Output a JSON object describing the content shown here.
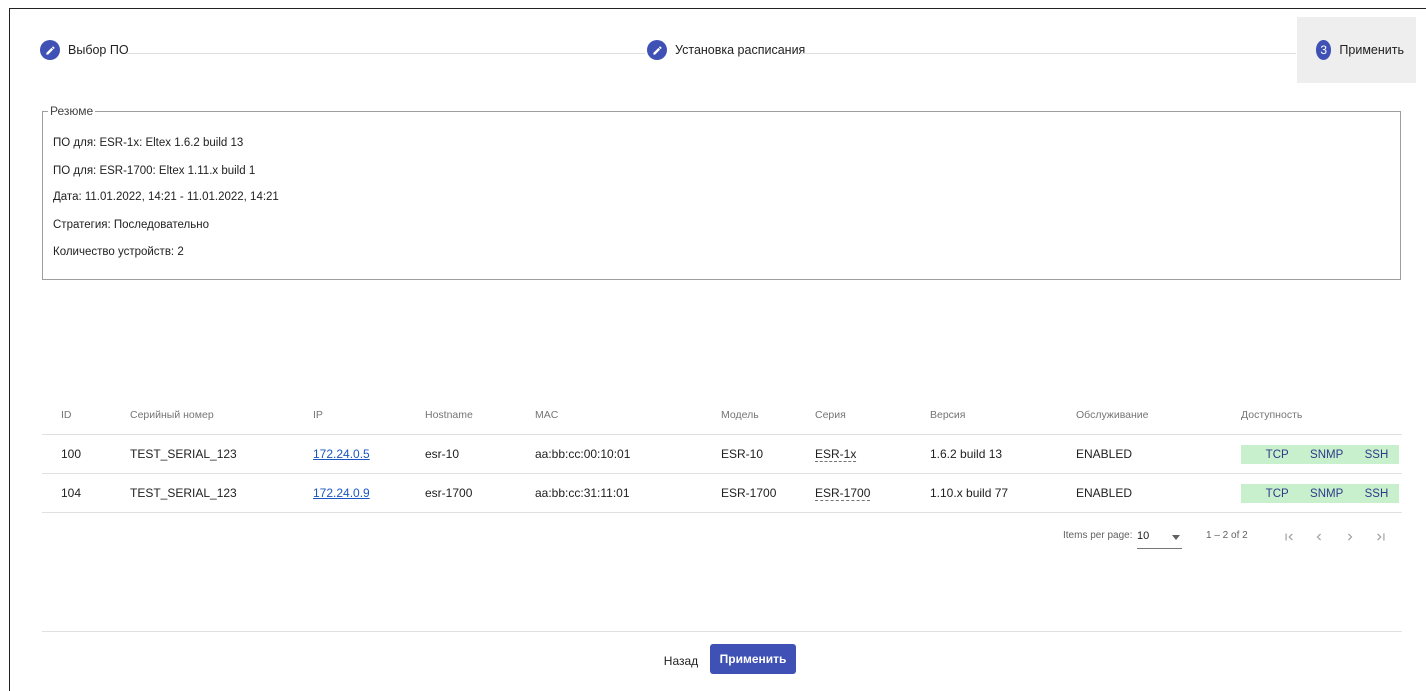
{
  "stepper": {
    "steps": [
      {
        "label": "Выбор ПО",
        "icon": "edit-icon"
      },
      {
        "label": "Установка расписания",
        "icon": "edit-icon"
      },
      {
        "label": "Применить",
        "number": "3"
      }
    ]
  },
  "summary": {
    "legend": "Резюме",
    "rows": [
      {
        "key": "ПО для: ESR-1x:",
        "value": " Eltex 1.6.2 build 13"
      },
      {
        "key": "ПО для: ESR-1700:",
        "value": " Eltex 1.11.x build 1"
      },
      {
        "key": "Дата:",
        "value": " 11.01.2022, 14:21 - 11.01.2022, 14:21"
      },
      {
        "key": "Стратегия:",
        "value": " Последовательно"
      },
      {
        "key": "Количество устройств:",
        "value": " 2"
      }
    ]
  },
  "table": {
    "headers": [
      "ID",
      "Серийный номер",
      "IP",
      "Hostname",
      "MAC",
      "Модель",
      "Серия",
      "Версия",
      "Обслуживание",
      "Доступность"
    ],
    "rows": [
      {
        "id": "100",
        "serial": "TEST_SERIAL_123",
        "ip": "172.24.0.5",
        "hostname": "esr-10",
        "mac": "aa:bb:cc:00:10:01",
        "model": "ESR-10",
        "series": "ESR-1x",
        "version": "1.6.2 build 13",
        "service": "ENABLED",
        "availability": [
          "TCP",
          "SNMP",
          "SSH"
        ]
      },
      {
        "id": "104",
        "serial": "TEST_SERIAL_123",
        "ip": "172.24.0.9",
        "hostname": "esr-1700",
        "mac": "aa:bb:cc:31:11:01",
        "model": "ESR-1700",
        "series": "ESR-1700",
        "version": "1.10.x build 77",
        "service": "ENABLED",
        "availability": [
          "TCP",
          "SNMP",
          "SSH"
        ]
      }
    ]
  },
  "paginator": {
    "items_per_page_label": "Items per page:",
    "page_size": "10",
    "range": "1 – 2 of 2"
  },
  "footer": {
    "back_label": "Назад",
    "apply_label": "Применить"
  },
  "colors": {
    "primary": "#3f51b5",
    "availability_bg": "#c8f0cc",
    "link": "#1a56c4"
  }
}
